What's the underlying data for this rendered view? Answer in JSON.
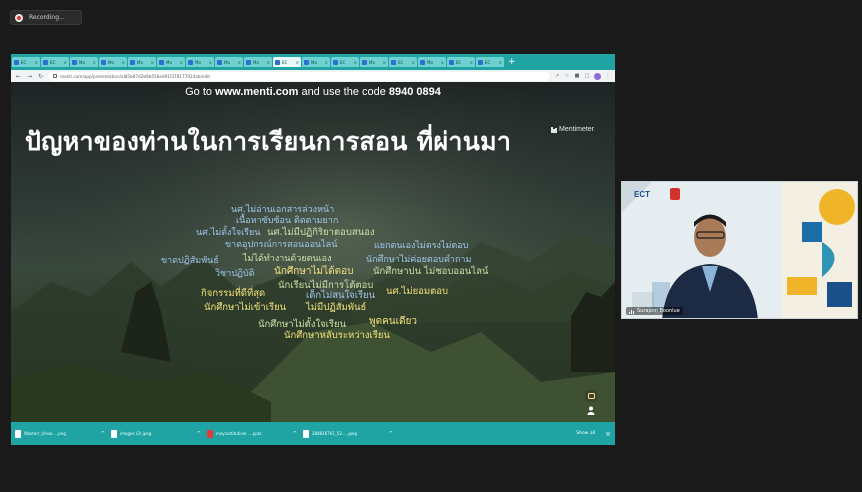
{
  "recording": {
    "label": "Recording..."
  },
  "browser": {
    "tabs": [
      {
        "label": "EC"
      },
      {
        "label": "EC"
      },
      {
        "label": "Mo"
      },
      {
        "label": "Mo"
      },
      {
        "label": "Mo"
      },
      {
        "label": "Mo"
      },
      {
        "label": "Mo"
      },
      {
        "label": "Mo"
      },
      {
        "label": "Mo"
      },
      {
        "label": "EC"
      },
      {
        "label": "Mo"
      },
      {
        "label": "EC"
      },
      {
        "label": "Mo"
      },
      {
        "label": "EC"
      },
      {
        "label": "Mo"
      },
      {
        "label": "EC"
      },
      {
        "label": "EC"
      }
    ],
    "active_tab_index": 9,
    "address": "menti.com/app/presentation/al85b87d2b9b556ed91f378177024ab/edit"
  },
  "slide": {
    "join_prefix": "Go to ",
    "join_site": "www.menti.com",
    "join_middle": " and use the code ",
    "join_code": "8940 0894",
    "title": "ปัญหาของท่านในการเรียนการสอน ที่ผ่านมา",
    "brand": "Mentimeter",
    "words": [
      {
        "text": "นศ.ไม่อ่านเอกสารล่วงหน้า",
        "color": "#9ec7ea"
      },
      {
        "text": "เนื้อหาซับซ้อน ติดตามยาก",
        "color": "#9ec7ea"
      },
      {
        "text": "นศ.ไม่ตั้งใจเรียน",
        "color": "#9ec7ea"
      },
      {
        "text": "นศ.ไม่มีปฏิกิริยาตอบสนอง",
        "color": "#c7e3a8"
      },
      {
        "text": "ขาดอุปกรณ์การสอนออนไลน์",
        "color": "#9ec7ea"
      },
      {
        "text": "แยกตนเองไม่ตรงไม่ตอบ",
        "color": "#9ec7ea"
      },
      {
        "text": "ไม่ได้ทำงานด้วยตนเอง",
        "color": "#c7e3a8"
      },
      {
        "text": "ขาดปฏิสัมพันธ์",
        "color": "#9ec7ea"
      },
      {
        "text": "นักศึกษาไม่ค่อยตอบคำถาม",
        "color": "#9ec7ea"
      },
      {
        "text": "วิชาปฏิบัติ",
        "color": "#9ec7ea"
      },
      {
        "text": "นักศึกษาไม่ได้ตอบ",
        "color": "#f2e27a"
      },
      {
        "text": "นักศึกษาบ่น ไม่ชอบออนไลน์",
        "color": "#c7e3a8"
      },
      {
        "text": "นักเรียนไม่มีการโต้ตอบ",
        "color": "#c7e3a8"
      },
      {
        "text": "กิจกรรมที่ดีที่สุด",
        "color": "#f2e27a"
      },
      {
        "text": "เด็กไม่สนใจเรียน",
        "color": "#9ec7ea"
      },
      {
        "text": "นศ.ไม่ยอมตอบ",
        "color": "#f2e27a"
      },
      {
        "text": "นักศึกษาไม่เข้าเรียน",
        "color": "#f2e27a"
      },
      {
        "text": "ไม่มีปฏิสัมพันธ์",
        "color": "#f2e27a"
      },
      {
        "text": "นักศึกษาไม่ตั้งใจเรียน",
        "color": "#c7e3a8"
      },
      {
        "text": "พูดคนเดียว",
        "color": "#f2e27a"
      },
      {
        "text": "นักศึกษาหลับระหว่างเรียน",
        "color": "#f2e27a"
      }
    ]
  },
  "downloads": {
    "items": [
      {
        "name": "Wasterr_Unsw.....png",
        "type": "img"
      },
      {
        "name": "images (2).jpeg",
        "type": "img"
      },
      {
        "name": "maysuttitutivel.....pptx",
        "type": "pdf"
      },
      {
        "name": "288816761_52.....jpeg",
        "type": "img"
      }
    ],
    "show_all": "Show all"
  },
  "participant": {
    "name": "Surapon Boonlue",
    "logo_text": "ECT"
  }
}
